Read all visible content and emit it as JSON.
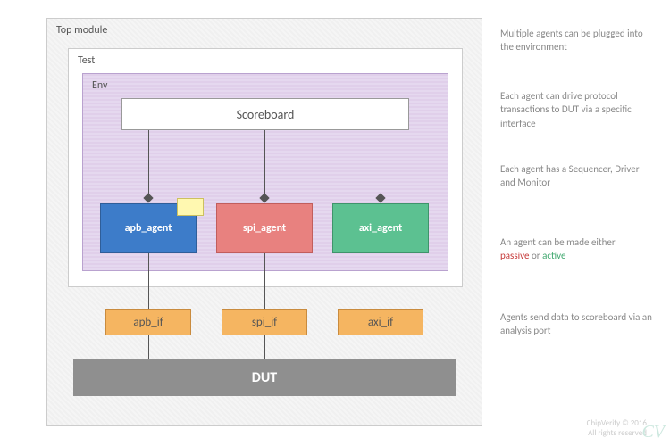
{
  "topModule": {
    "title": "Top module"
  },
  "test": {
    "title": "Test"
  },
  "env": {
    "title": "Env"
  },
  "scoreboard": {
    "label": "Scoreboard"
  },
  "agents": [
    {
      "name": "apb_agent",
      "iface": "apb_if"
    },
    {
      "name": "spi_agent",
      "iface": "spi_if"
    },
    {
      "name": "axi_agent",
      "iface": "axi_if"
    }
  ],
  "dut": {
    "label": "DUT"
  },
  "notes": [
    "Multiple agents can be plugged into the environment",
    "Each agent can drive protocol transactions to DUT via a specific interface",
    "Each agent has a Sequencer, Driver and Monitor",
    "An agent can be made either",
    "Agents send data to scoreboard via an analysis port"
  ],
  "passive": "passive",
  "active": "active",
  "or": " or ",
  "footer": {
    "line1": "ChipVerify © 2016",
    "line2": "All rights reserved"
  },
  "logo": "CV"
}
